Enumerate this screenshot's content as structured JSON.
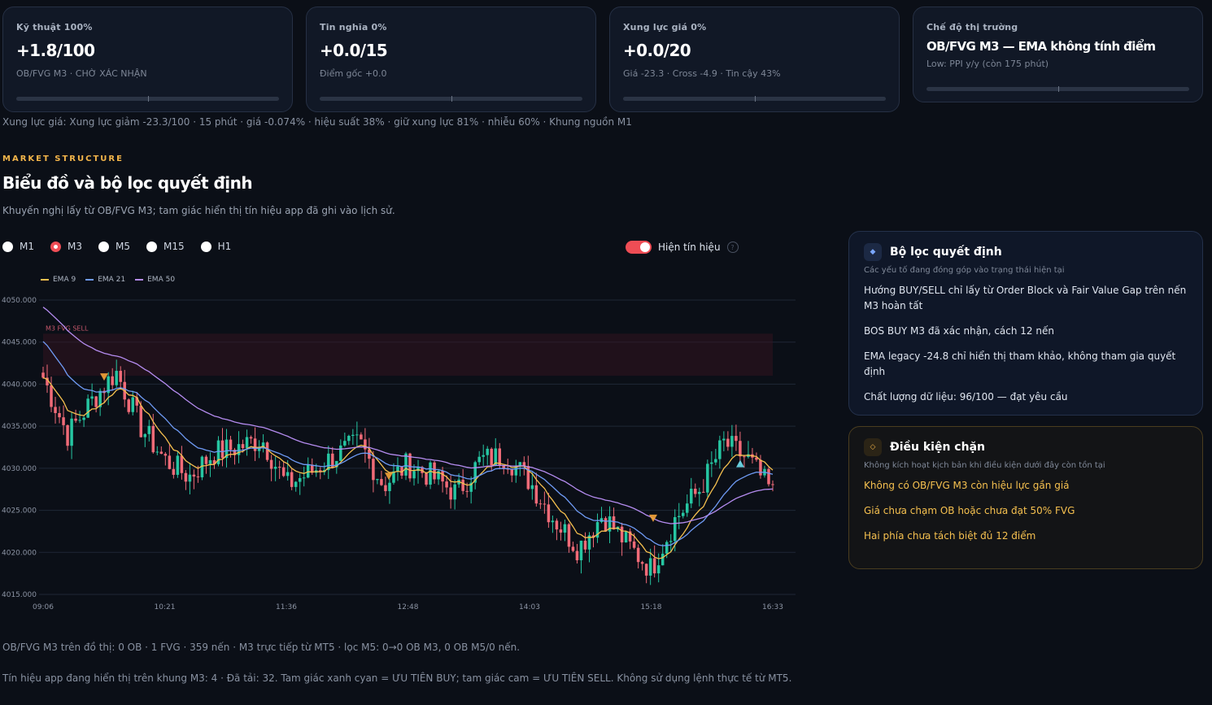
{
  "cards": [
    {
      "title": "Kỹ thuật 100%",
      "value": "+1.8/100",
      "sub": "OB/FVG M3 · CHỜ XÁC NHẬN"
    },
    {
      "title": "Tin nghĩa 0%",
      "value": "+0.0/15",
      "sub": "Điểm gốc +0.0"
    },
    {
      "title": "Xung lực giá 0%",
      "value": "+0.0/20",
      "sub": "Giá -23.3 · Cross -4.9 · Tin cậy 43%"
    },
    {
      "title": "Chế độ thị trường",
      "value": "OB/FVG M3 — EMA không tính điểm",
      "sub": "Low: PPI y/y (còn 175 phút)"
    }
  ],
  "impulse_line": "Xung lực giá: Xung lực giảm -23.3/100 · 15 phút · giá -0.074% · hiệu suất 38% · giữ xung lực 81% · nhiễu 60% · Khung nguồn M1",
  "section": {
    "eyebrow": "MARKET STRUCTURE",
    "title": "Biểu đồ và bộ lọc quyết định",
    "desc": "Khuyến nghị lấy từ OB/FVG M3; tam giác hiển thị tín hiệu app đã ghi vào lịch sử."
  },
  "timeframes": [
    "M1",
    "M3",
    "M5",
    "M15",
    "H1"
  ],
  "selected_timeframe": "M3",
  "toggle": {
    "label": "Hiện tín hiệu",
    "on": true,
    "help": "?"
  },
  "legend": [
    {
      "name": "EMA 9",
      "color": "#f5c04f"
    },
    {
      "name": "EMA 21",
      "color": "#6f9bf5"
    },
    {
      "name": "EMA 50",
      "color": "#b58cf0"
    }
  ],
  "colors": {
    "up": "#26c6a2",
    "down": "#f06b78",
    "accent": "#ef4d55",
    "warning": "#f5c04f"
  },
  "chart_data": {
    "type": "candlestick",
    "ylim": [
      4015,
      4050
    ],
    "yticks": [
      "4050.000",
      "4045.000",
      "4040.000",
      "4035.000",
      "4030.000",
      "4025.000",
      "4020.000",
      "4015.000"
    ],
    "xticks": [
      "09:06",
      "10:21",
      "11:36",
      "12:48",
      "14:03",
      "15:18",
      "16:33"
    ],
    "grid": true,
    "zone": {
      "label": "M3 FVG SELL",
      "from": 4041,
      "to": 4046
    },
    "key_closes": [
      4040.8,
      4034,
      4038,
      4041.5,
      4035,
      4031,
      4029,
      4031.8,
      4032.5,
      4033.5,
      4028,
      4029.5,
      4031.5,
      4033,
      4028,
      4030.5,
      4029,
      4027,
      4031,
      4031.5,
      4028.5,
      4024,
      4020.5,
      4024.5,
      4021,
      4018,
      4024,
      4027.5,
      4033,
      4031,
      4027
    ]
  },
  "filter_panel": {
    "icon": "◆",
    "title": "Bộ lọc quyết định",
    "sub": "Các yếu tố đang đóng góp vào trạng thái hiện tại",
    "items": [
      "Hướng BUY/SELL chỉ lấy từ Order Block và Fair Value Gap trên nến M3 hoàn tất",
      "BOS BUY M3 đã xác nhận, cách 12 nến",
      "EMA legacy -24.8 chỉ hiển thị tham khảo, không tham gia quyết định",
      "Chất lượng dữ liệu: 96/100 — đạt yêu cầu"
    ]
  },
  "block_panel": {
    "icon": "◇",
    "title": "Điều kiện chặn",
    "sub": "Không kích hoạt kịch bản khi điều kiện dưới đây còn tồn tại",
    "items": [
      "Không có OB/FVG M3 còn hiệu lực gần giá",
      "Giá chưa chạm OB hoặc chưa đạt 50% FVG",
      "Hai phía chưa tách biệt đủ 12 điểm"
    ]
  },
  "footnotes": [
    "OB/FVG M3 trên đồ thị: 0 OB · 1 FVG · 359 nến · M3 trực tiếp từ MT5 · lọc M5: 0→0 OB M3, 0 OB M5/0 nến.",
    "Tín hiệu app đang hiển thị trên khung M3: 4 · Đã tải: 32. Tam giác xanh cyan = ƯU TIÊN BUY; tam giác cam = ƯU TIÊN SELL. Không sử dụng lệnh thực tế từ MT5."
  ]
}
